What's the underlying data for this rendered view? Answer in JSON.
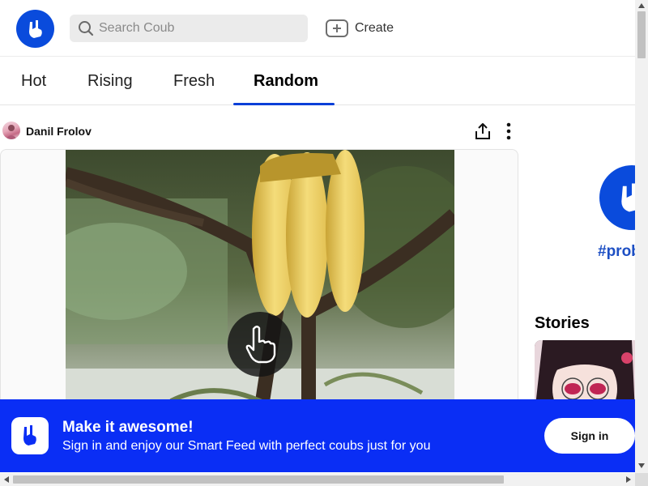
{
  "header": {
    "search_placeholder": "Search Coub",
    "create_label": "Create"
  },
  "tabs": [
    {
      "label": "Hot",
      "active": false
    },
    {
      "label": "Rising",
      "active": false
    },
    {
      "label": "Fresh",
      "active": false
    },
    {
      "label": "Random",
      "active": true
    }
  ],
  "post": {
    "author": "Danil Frolov"
  },
  "sidebar": {
    "tag": "#prob",
    "stories_title": "Stories"
  },
  "banner": {
    "title": "Make it awesome!",
    "subtitle": "Sign in and enjoy our Smart Feed with perfect coubs just for you",
    "signin_label": "Sign in"
  },
  "colors": {
    "brand_blue": "#0a4bdc",
    "banner_blue": "#0a2ef5",
    "tab_underline": "#0a3fd8",
    "tag_blue": "#1d4fc4"
  },
  "icons": {
    "logo": "rock-hand-icon",
    "search": "search-icon",
    "create": "plus-box-icon",
    "share": "share-upload-icon",
    "more": "vertical-dots-icon",
    "play": "pointing-hand-icon"
  }
}
